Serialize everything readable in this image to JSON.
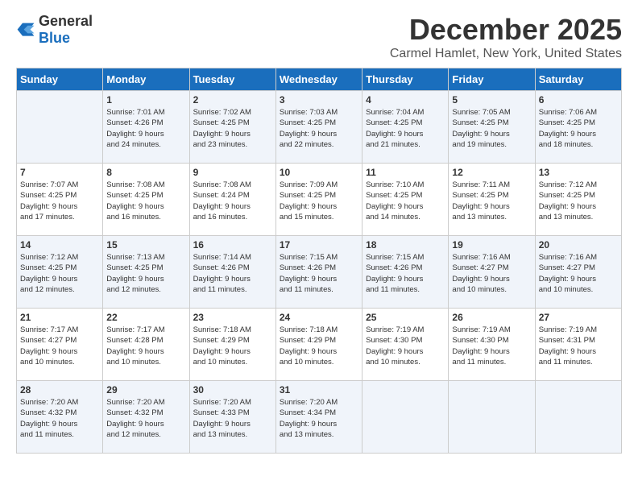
{
  "logo": {
    "general": "General",
    "blue": "Blue"
  },
  "title": "December 2025",
  "location": "Carmel Hamlet, New York, United States",
  "days_header": [
    "Sunday",
    "Monday",
    "Tuesday",
    "Wednesday",
    "Thursday",
    "Friday",
    "Saturday"
  ],
  "weeks": [
    [
      {
        "day": "",
        "info": ""
      },
      {
        "day": "1",
        "info": "Sunrise: 7:01 AM\nSunset: 4:26 PM\nDaylight: 9 hours\nand 24 minutes."
      },
      {
        "day": "2",
        "info": "Sunrise: 7:02 AM\nSunset: 4:25 PM\nDaylight: 9 hours\nand 23 minutes."
      },
      {
        "day": "3",
        "info": "Sunrise: 7:03 AM\nSunset: 4:25 PM\nDaylight: 9 hours\nand 22 minutes."
      },
      {
        "day": "4",
        "info": "Sunrise: 7:04 AM\nSunset: 4:25 PM\nDaylight: 9 hours\nand 21 minutes."
      },
      {
        "day": "5",
        "info": "Sunrise: 7:05 AM\nSunset: 4:25 PM\nDaylight: 9 hours\nand 19 minutes."
      },
      {
        "day": "6",
        "info": "Sunrise: 7:06 AM\nSunset: 4:25 PM\nDaylight: 9 hours\nand 18 minutes."
      }
    ],
    [
      {
        "day": "7",
        "info": "Sunrise: 7:07 AM\nSunset: 4:25 PM\nDaylight: 9 hours\nand 17 minutes."
      },
      {
        "day": "8",
        "info": "Sunrise: 7:08 AM\nSunset: 4:25 PM\nDaylight: 9 hours\nand 16 minutes."
      },
      {
        "day": "9",
        "info": "Sunrise: 7:08 AM\nSunset: 4:24 PM\nDaylight: 9 hours\nand 16 minutes."
      },
      {
        "day": "10",
        "info": "Sunrise: 7:09 AM\nSunset: 4:25 PM\nDaylight: 9 hours\nand 15 minutes."
      },
      {
        "day": "11",
        "info": "Sunrise: 7:10 AM\nSunset: 4:25 PM\nDaylight: 9 hours\nand 14 minutes."
      },
      {
        "day": "12",
        "info": "Sunrise: 7:11 AM\nSunset: 4:25 PM\nDaylight: 9 hours\nand 13 minutes."
      },
      {
        "day": "13",
        "info": "Sunrise: 7:12 AM\nSunset: 4:25 PM\nDaylight: 9 hours\nand 13 minutes."
      }
    ],
    [
      {
        "day": "14",
        "info": "Sunrise: 7:12 AM\nSunset: 4:25 PM\nDaylight: 9 hours\nand 12 minutes."
      },
      {
        "day": "15",
        "info": "Sunrise: 7:13 AM\nSunset: 4:25 PM\nDaylight: 9 hours\nand 12 minutes."
      },
      {
        "day": "16",
        "info": "Sunrise: 7:14 AM\nSunset: 4:26 PM\nDaylight: 9 hours\nand 11 minutes."
      },
      {
        "day": "17",
        "info": "Sunrise: 7:15 AM\nSunset: 4:26 PM\nDaylight: 9 hours\nand 11 minutes."
      },
      {
        "day": "18",
        "info": "Sunrise: 7:15 AM\nSunset: 4:26 PM\nDaylight: 9 hours\nand 11 minutes."
      },
      {
        "day": "19",
        "info": "Sunrise: 7:16 AM\nSunset: 4:27 PM\nDaylight: 9 hours\nand 10 minutes."
      },
      {
        "day": "20",
        "info": "Sunrise: 7:16 AM\nSunset: 4:27 PM\nDaylight: 9 hours\nand 10 minutes."
      }
    ],
    [
      {
        "day": "21",
        "info": "Sunrise: 7:17 AM\nSunset: 4:27 PM\nDaylight: 9 hours\nand 10 minutes."
      },
      {
        "day": "22",
        "info": "Sunrise: 7:17 AM\nSunset: 4:28 PM\nDaylight: 9 hours\nand 10 minutes."
      },
      {
        "day": "23",
        "info": "Sunrise: 7:18 AM\nSunset: 4:29 PM\nDaylight: 9 hours\nand 10 minutes."
      },
      {
        "day": "24",
        "info": "Sunrise: 7:18 AM\nSunset: 4:29 PM\nDaylight: 9 hours\nand 10 minutes."
      },
      {
        "day": "25",
        "info": "Sunrise: 7:19 AM\nSunset: 4:30 PM\nDaylight: 9 hours\nand 10 minutes."
      },
      {
        "day": "26",
        "info": "Sunrise: 7:19 AM\nSunset: 4:30 PM\nDaylight: 9 hours\nand 11 minutes."
      },
      {
        "day": "27",
        "info": "Sunrise: 7:19 AM\nSunset: 4:31 PM\nDaylight: 9 hours\nand 11 minutes."
      }
    ],
    [
      {
        "day": "28",
        "info": "Sunrise: 7:20 AM\nSunset: 4:32 PM\nDaylight: 9 hours\nand 11 minutes."
      },
      {
        "day": "29",
        "info": "Sunrise: 7:20 AM\nSunset: 4:32 PM\nDaylight: 9 hours\nand 12 minutes."
      },
      {
        "day": "30",
        "info": "Sunrise: 7:20 AM\nSunset: 4:33 PM\nDaylight: 9 hours\nand 13 minutes."
      },
      {
        "day": "31",
        "info": "Sunrise: 7:20 AM\nSunset: 4:34 PM\nDaylight: 9 hours\nand 13 minutes."
      },
      {
        "day": "",
        "info": ""
      },
      {
        "day": "",
        "info": ""
      },
      {
        "day": "",
        "info": ""
      }
    ]
  ]
}
